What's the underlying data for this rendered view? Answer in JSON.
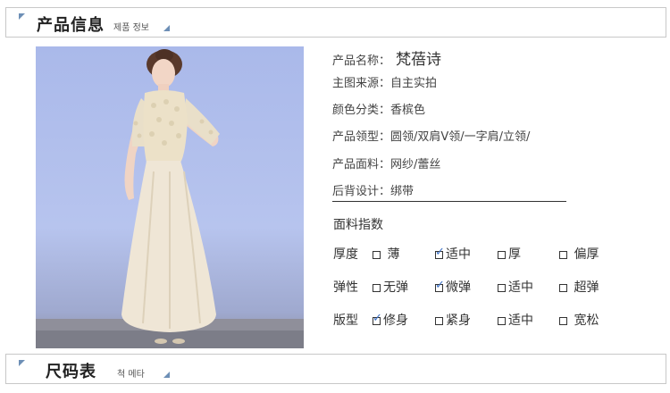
{
  "header": {
    "title": "产品信息",
    "subtitle": "제품 정보"
  },
  "product": {
    "rows": [
      {
        "label": "产品名称：",
        "value": "梵蓓诗"
      },
      {
        "label": "主图来源：",
        "value": "自主实拍"
      },
      {
        "label": "颜色分类：",
        "value": "香槟色"
      },
      {
        "label": "产品领型：",
        "value": "圆领/双肩V领/一字肩/立领/"
      },
      {
        "label": "产品面料：",
        "value": "网纱/蕾丝"
      },
      {
        "label": "后背设计：",
        "value": "绑带"
      }
    ]
  },
  "fabric_index": {
    "title": "面料指数",
    "rows": [
      {
        "label": "厚度",
        "options": [
          {
            "text": "薄",
            "checked": false
          },
          {
            "text": "适中",
            "checked": true
          },
          {
            "text": "厚",
            "checked": false
          },
          {
            "text": "偏厚",
            "checked": false
          }
        ]
      },
      {
        "label": "弹性",
        "options": [
          {
            "text": "无弹",
            "checked": false
          },
          {
            "text": "微弹",
            "checked": true
          },
          {
            "text": "适中",
            "checked": false
          },
          {
            "text": "超弹",
            "checked": false
          }
        ]
      },
      {
        "label": "版型",
        "options": [
          {
            "text": "修身",
            "checked": true
          },
          {
            "text": "紧身",
            "checked": false
          },
          {
            "text": "适中",
            "checked": false
          },
          {
            "text": "宽松",
            "checked": false
          }
        ]
      }
    ]
  },
  "footer": {
    "title": "尺码表",
    "subtitle": "척 메타"
  },
  "colors": {
    "accent": "#6d8fb6",
    "check": "#3d72c8",
    "border": "#c8c8c8"
  },
  "icons": {
    "section_marker": "corner-triangle-icon",
    "checkmark": "checkmark-icon"
  }
}
